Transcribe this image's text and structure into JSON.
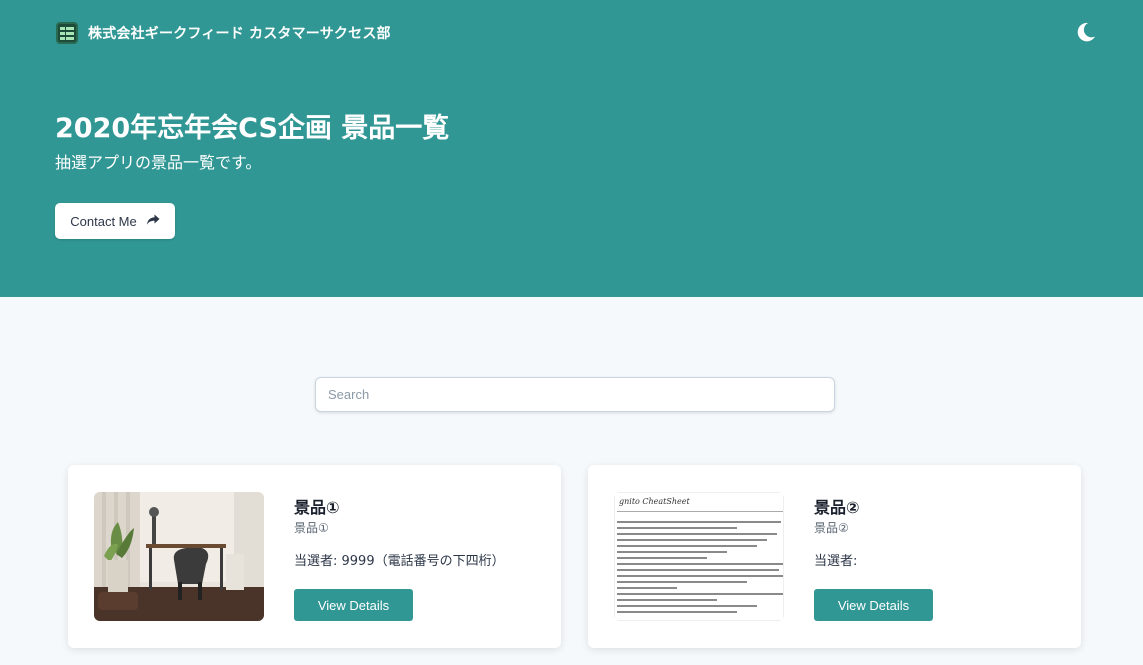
{
  "header": {
    "brand_name": "株式会社ギークフィード カスタマーサクセス部",
    "theme_toggle_icon": "moon-icon"
  },
  "hero": {
    "title": "2020年忘年会CS企画 景品一覧",
    "subtitle": "抽選アプリの景品一覧です。",
    "contact_label": "Contact Me",
    "contact_icon": "share-arrow-icon"
  },
  "search": {
    "placeholder": "Search",
    "value": ""
  },
  "prizes": [
    {
      "title": "景品①",
      "description": "景品①",
      "winner": "当選者: 9999（電話番号の下四桁）",
      "button_label": "View Details",
      "image": "desk-room-photo"
    },
    {
      "title": "景品②",
      "description": "景品②",
      "winner": "当選者:",
      "button_label": "View Details",
      "image": "cognito-cheatsheet-document",
      "image_heading": "gnito CheatSheet"
    }
  ],
  "colors": {
    "accent": "#319795",
    "background": "#f5f9fb",
    "card": "#ffffff"
  }
}
